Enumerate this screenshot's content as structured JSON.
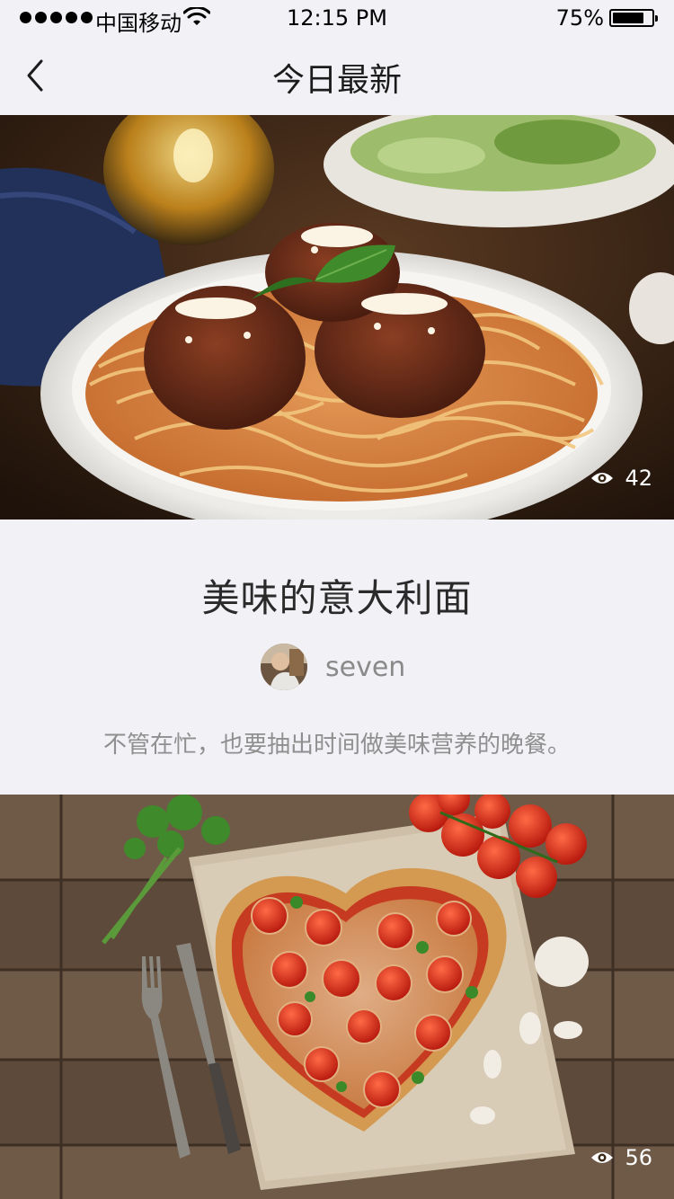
{
  "status_bar": {
    "carrier": "中国移动",
    "time": "12:15 PM",
    "battery": "75%"
  },
  "nav": {
    "title": "今日最新",
    "back_icon": "chevron-left-icon"
  },
  "articles": [
    {
      "image": "spaghetti-meatballs-photo",
      "views": "42",
      "title": "美味的意大利面",
      "author": "seven",
      "description": "不管在忙，也要抽出时间做美味营养的晚餐。"
    },
    {
      "image": "heart-pizza-photo",
      "views": "56"
    }
  ],
  "colors": {
    "background": "#f2f1f6",
    "title_text": "#2a2a2a",
    "muted_text": "#8f8f8f"
  }
}
